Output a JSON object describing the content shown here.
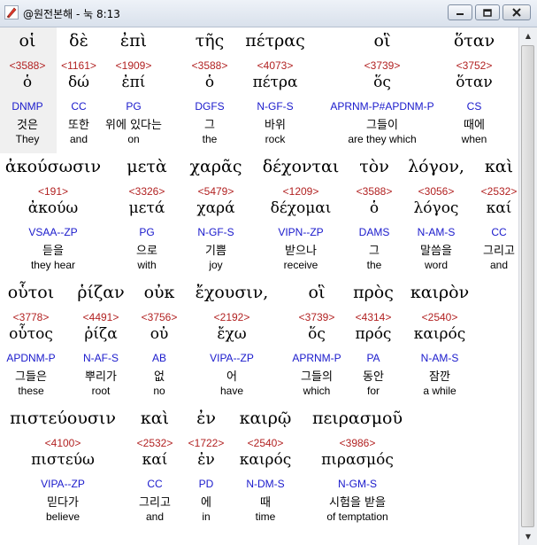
{
  "window": {
    "title": "@원전본해 - 눅 8:13"
  },
  "rows": [
    {
      "words": [
        {
          "gk": "οἱ",
          "num": "<3588>",
          "lemma": "ὁ",
          "parse": "DNMP",
          "kr": "것은",
          "en": "They"
        },
        {
          "gk": "δὲ",
          "num": "<1161>",
          "lemma": "δώ",
          "parse": "CC",
          "kr": "또한",
          "en": "and"
        },
        {
          "gk": "ἐπὶ",
          "num": "<1909>",
          "lemma": "ἐπί",
          "parse": "PG",
          "kr": "위에 있다는",
          "en": "on"
        },
        {
          "gk": "τῆς",
          "num": "<3588>",
          "lemma": "ὁ",
          "parse": "DGFS",
          "kr": "그",
          "en": "the"
        },
        {
          "gk": "πέτρας",
          "num": "<4073>",
          "lemma": "πέτρα",
          "parse": "N-GF-S",
          "kr": "바위",
          "en": "rock"
        },
        {
          "gk": "οἳ",
          "num": "<3739>",
          "lemma": "ὅς",
          "parse": "APRNM-P#APDNM-P",
          "kr": "그들이",
          "en": "are they which"
        },
        {
          "gk": "ὅταν",
          "num": "<3752>",
          "lemma": "ὅταν",
          "parse": "CS",
          "kr": "때에",
          "en": "when"
        }
      ]
    },
    {
      "words": [
        {
          "gk": "ἀκούσωσιν",
          "num": "<191>",
          "lemma": "ἀκούω",
          "parse": "VSAA--ZP",
          "kr": "듣을",
          "en": "they hear"
        },
        {
          "gk": "μετὰ",
          "num": "<3326>",
          "lemma": "μετά",
          "parse": "PG",
          "kr": "으로",
          "en": "with"
        },
        {
          "gk": "χαρᾶς",
          "num": "<5479>",
          "lemma": "χαρά",
          "parse": "N-GF-S",
          "kr": "기쁨",
          "en": "joy"
        },
        {
          "gk": "δέχονται",
          "num": "<1209>",
          "lemma": "δέχομαι",
          "parse": "VIPN--ZP",
          "kr": "받으나",
          "en": "receive"
        },
        {
          "gk": "τὸν",
          "num": "<3588>",
          "lemma": "ὁ",
          "parse": "DAMS",
          "kr": "그",
          "en": "the"
        },
        {
          "gk": "λόγον,",
          "num": "<3056>",
          "lemma": "λόγος",
          "parse": "N-AM-S",
          "kr": "말씀을",
          "en": "word"
        },
        {
          "gk": "καὶ",
          "num": "<2532>",
          "lemma": "καί",
          "parse": "CC",
          "kr": "그리고",
          "en": "and"
        }
      ]
    },
    {
      "words": [
        {
          "gk": "οὗτοι",
          "num": "<3778>",
          "lemma": "οὗτος",
          "parse": "APDNM-P",
          "kr": "그들은",
          "en": "these"
        },
        {
          "gk": "ῥίζαν",
          "num": "<4491>",
          "lemma": "ῥίζα",
          "parse": "N-AF-S",
          "kr": "뿌리가",
          "en": "root"
        },
        {
          "gk": "οὐκ",
          "num": "<3756>",
          "lemma": "οὐ",
          "parse": "AB",
          "kr": "없",
          "en": "no"
        },
        {
          "gk": "ἔχουσιν,",
          "num": "<2192>",
          "lemma": "ἔχω",
          "parse": "VIPA--ZP",
          "kr": "어",
          "en": "have"
        },
        {
          "gk": "οἳ",
          "num": "<3739>",
          "lemma": "ὅς",
          "parse": "APRNM-P",
          "kr": "그들의",
          "en": "which"
        },
        {
          "gk": "πρὸς",
          "num": "<4314>",
          "lemma": "πρός",
          "parse": "PA",
          "kr": "동안",
          "en": "for"
        },
        {
          "gk": "καιρὸν",
          "num": "<2540>",
          "lemma": "καιρός",
          "parse": "N-AM-S",
          "kr": "잠깐",
          "en": "a while"
        }
      ]
    },
    {
      "words": [
        {
          "gk": "πιστεύουσιν",
          "num": "<4100>",
          "lemma": "πιστεύω",
          "parse": "VIPA--ZP",
          "kr": "믿다가",
          "en": "believe"
        },
        {
          "gk": "καὶ",
          "num": "<2532>",
          "lemma": "καί",
          "parse": "CC",
          "kr": "그리고",
          "en": "and"
        },
        {
          "gk": "ἐν",
          "num": "<1722>",
          "lemma": "ἐν",
          "parse": "PD",
          "kr": "에",
          "en": "in"
        },
        {
          "gk": "καιρῷ",
          "num": "<2540>",
          "lemma": "καιρός",
          "parse": "N-DM-S",
          "kr": "때",
          "en": "time"
        },
        {
          "gk": "πειρασμοῦ",
          "num": "<3986>",
          "lemma": "πιρασμός",
          "parse": "N-GM-S",
          "kr": "시험을 받을",
          "en": "of temptation"
        }
      ]
    }
  ],
  "colors": {
    "strongs": "#b22222",
    "parsing": "#1a1acc",
    "selected_bg": "#f0f0f0"
  },
  "icons": {
    "app": "edit-pencil-icon",
    "minimize": "minimize-icon",
    "maximize": "maximize-icon",
    "close": "close-icon"
  }
}
